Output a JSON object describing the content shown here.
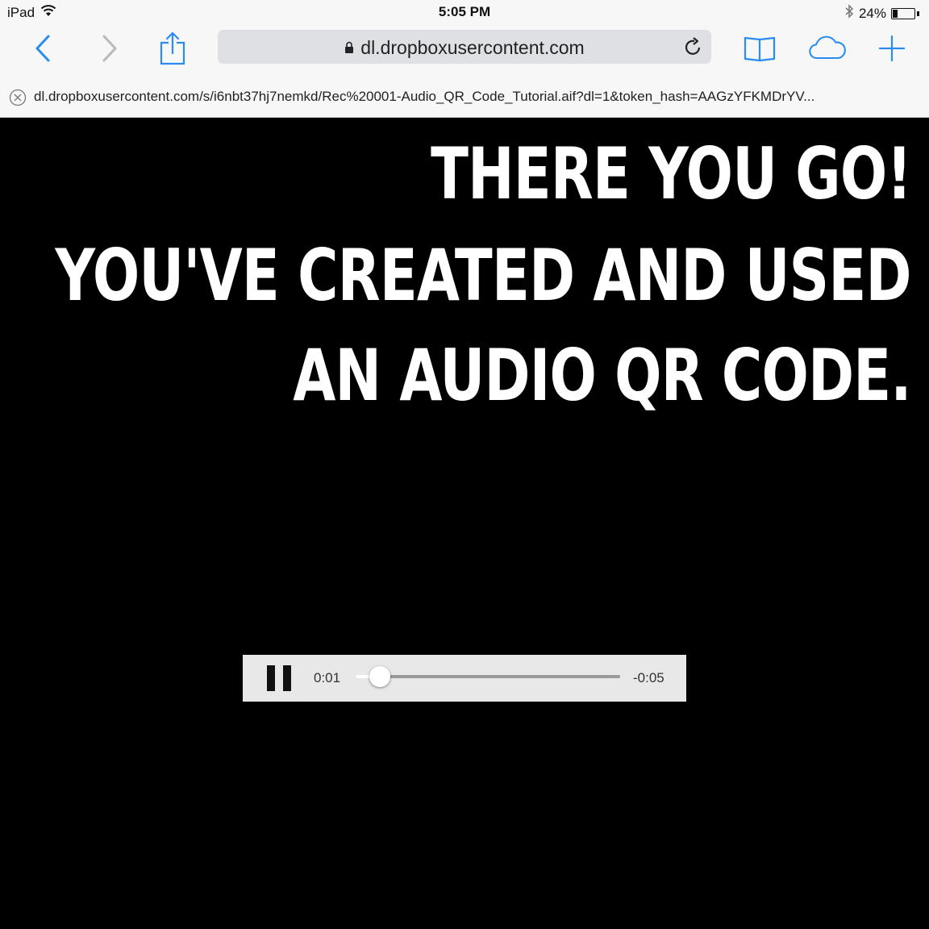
{
  "status": {
    "device": "iPad",
    "time": "5:05 PM",
    "battery_text": "24%",
    "battery_level": 0.24
  },
  "toolbar": {
    "url_display": "dl.dropboxusercontent.com",
    "accent_color": "#2a8cf0"
  },
  "subbar": {
    "full_url": "dl.dropboxusercontent.com/s/i6nbt37hj7nemkd/Rec%20001-Audio_QR_Code_Tutorial.aif?dl=1&token_hash=AAGzYFKMDrYV..."
  },
  "content": {
    "line1": "THERE YOU GO!",
    "line2": "YOU'VE CREATED AND USED",
    "line3": "AN AUDIO QR CODE."
  },
  "player": {
    "elapsed": "0:01",
    "remaining": "-0:05",
    "progress": 0.09
  }
}
